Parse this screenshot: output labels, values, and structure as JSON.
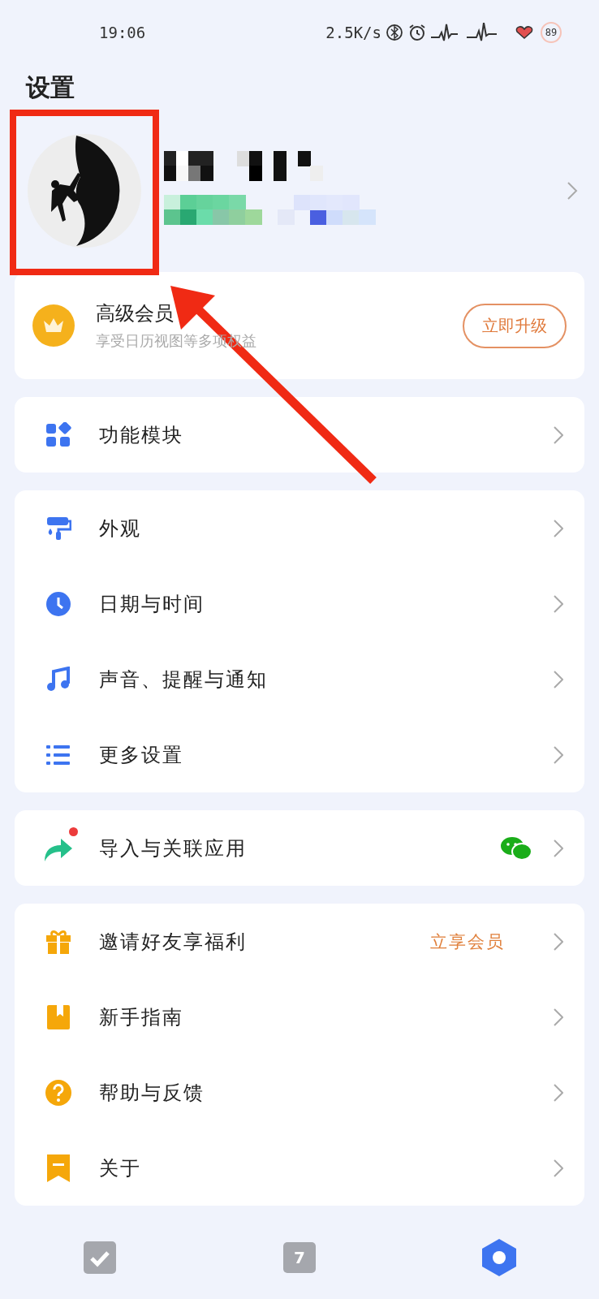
{
  "status_bar": {
    "time": "19:06",
    "net_speed": "2.5K/s",
    "battery": "89"
  },
  "title": "设置",
  "member": {
    "title": "高级会员",
    "subtitle": "享受日历视图等多项权益",
    "button": "立即升级"
  },
  "groups": [
    [
      {
        "label": "功能模块",
        "dot": false
      }
    ],
    [
      {
        "label": "外观",
        "dot": false
      },
      {
        "label": "日期与时间",
        "dot": false
      },
      {
        "label": "声音、提醒与通知",
        "dot": false
      },
      {
        "label": "更多设置",
        "dot": false
      }
    ],
    [
      {
        "label": "导入与关联应用",
        "dot": true
      }
    ],
    [
      {
        "label": "邀请好友享福利",
        "dot": false,
        "tag": "立享会员"
      },
      {
        "label": "新手指南",
        "dot": false
      },
      {
        "label": "帮助与反馈",
        "dot": false
      },
      {
        "label": "关于",
        "dot": false
      }
    ]
  ],
  "tabs": [
    {
      "selected": false
    },
    {
      "label": "7",
      "selected": false
    },
    {
      "selected": true
    }
  ]
}
